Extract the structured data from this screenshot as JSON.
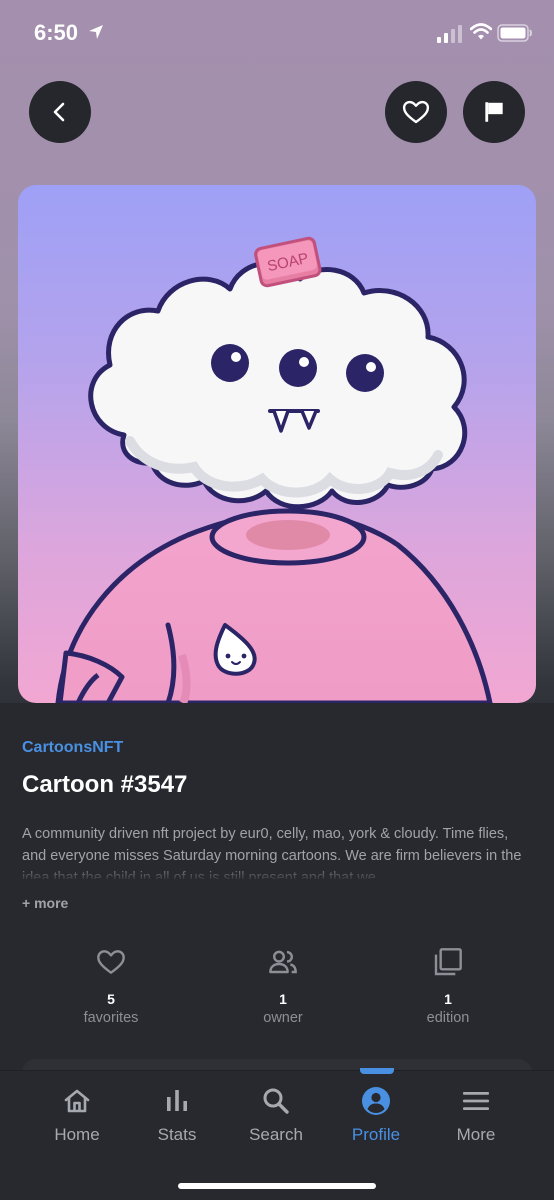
{
  "status_bar": {
    "time": "6:50"
  },
  "header": {
    "back_icon": "chevron-left-icon",
    "favorite_icon": "heart-outline-icon",
    "report_icon": "flag-icon"
  },
  "nft": {
    "collection": "CartoonsNFT",
    "title": "Cartoon #3547",
    "description": "A community driven nft project by eur0, celly, mao, york & cloudy. Time flies, and everyone misses Saturday morning cartoons. We are firm believers in the idea that the child in all of us is still present and that we",
    "more_label": "+ more",
    "artwork_sign_text": "SOAP"
  },
  "stats": [
    {
      "icon": "heart-outline-icon",
      "value": "5",
      "label": "favorites"
    },
    {
      "icon": "people-icon",
      "value": "1",
      "label": "owner"
    },
    {
      "icon": "copies-icon",
      "value": "1",
      "label": "edition"
    }
  ],
  "tabs": [
    {
      "label": "Home",
      "icon": "home-icon",
      "active": false
    },
    {
      "label": "Stats",
      "icon": "bar-chart-icon",
      "active": false
    },
    {
      "label": "Search",
      "icon": "search-icon",
      "active": false
    },
    {
      "label": "Profile",
      "icon": "profile-icon",
      "active": true
    },
    {
      "label": "More",
      "icon": "menu-icon",
      "active": false
    }
  ],
  "colors": {
    "accent": "#4a90e2",
    "panel": "#27292e",
    "button": "#25272c",
    "muted_text": "#a0a3a9"
  }
}
